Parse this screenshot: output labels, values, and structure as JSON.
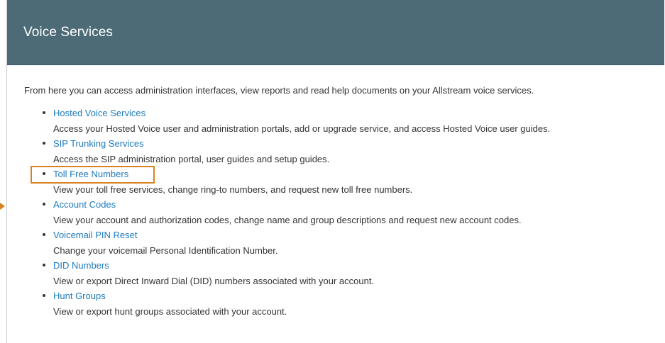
{
  "header": {
    "title": "Voice Services"
  },
  "intro": "From here you can access administration interfaces, view reports and read help documents on your Allstream voice services.",
  "services": [
    {
      "label": "Hosted Voice Services",
      "description": "Access your Hosted Voice user and administration portals, add or upgrade service, and access Hosted Voice user guides."
    },
    {
      "label": "SIP Trunking Services",
      "description": "Access the SIP administration portal, user guides and setup guides."
    },
    {
      "label": "Toll Free Numbers",
      "description": "View your toll free services, change ring-to numbers, and request new toll free numbers."
    },
    {
      "label": "Account Codes",
      "description": "View your account and authorization codes, change name and group descriptions and request new account codes."
    },
    {
      "label": "Voicemail PIN Reset",
      "description": "Change your voicemail Personal Identification Number."
    },
    {
      "label": "DID Numbers",
      "description": "View or export Direct Inward Dial (DID) numbers associated with your account."
    },
    {
      "label": "Hunt Groups",
      "description": "View or export hunt groups associated with your account."
    }
  ],
  "colors": {
    "header_bg": "#4d6a77",
    "link": "#1f7bbf",
    "highlight": "#d88321",
    "text": "#333333"
  }
}
